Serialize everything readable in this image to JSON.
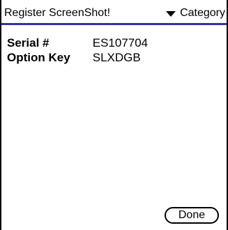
{
  "form": {
    "title": "Register ScreenShot!",
    "category_label": "Category",
    "category_icon": "triangle-down-icon",
    "accent_color": "#3a2fa6"
  },
  "fields": {
    "serial": {
      "label": "Serial #",
      "value": "ES107704"
    },
    "option_key": {
      "label": "Option Key",
      "value": "SLXDGB"
    }
  },
  "buttons": {
    "done_label": "Done"
  }
}
